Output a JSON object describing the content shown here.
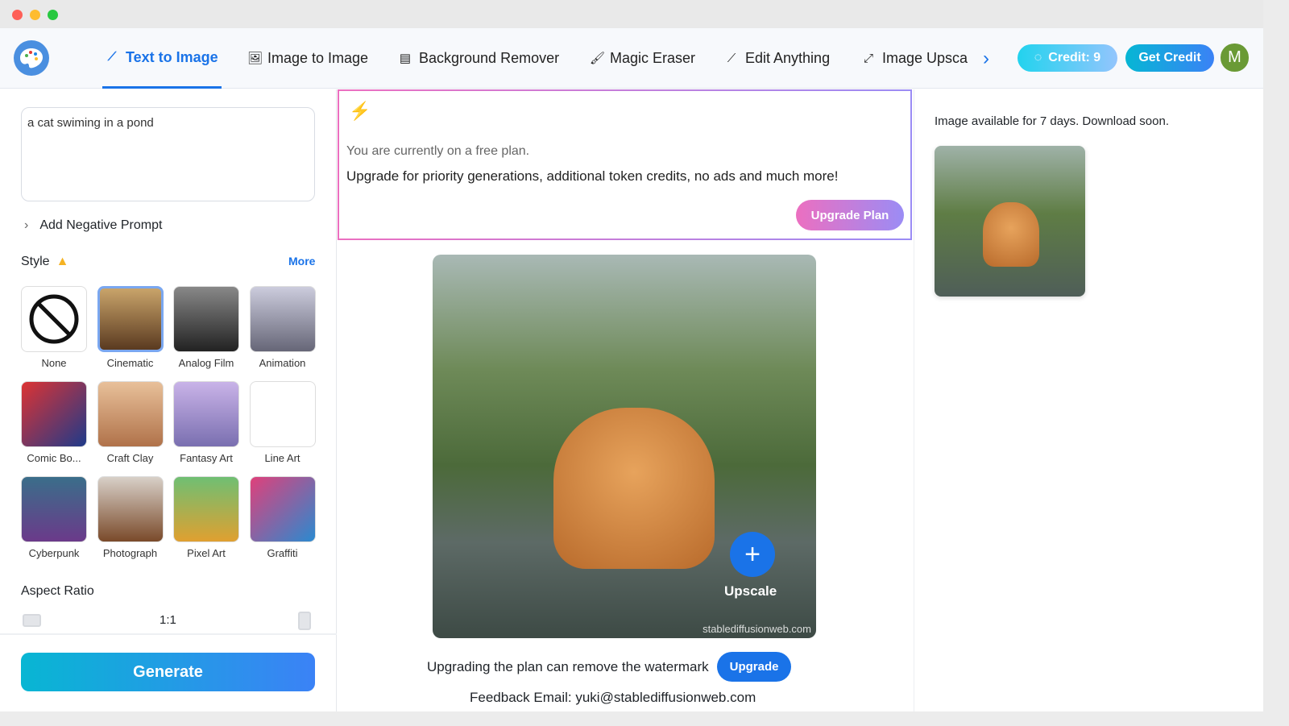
{
  "window": {
    "controls": [
      "close",
      "minimize",
      "maximize"
    ]
  },
  "nav": {
    "tabs": [
      {
        "label": "Text to Image",
        "icon": "magic-wand-icon",
        "active": true
      },
      {
        "label": "Image to Image",
        "icon": "image-icon"
      },
      {
        "label": "Background Remover",
        "icon": "background-remover-icon"
      },
      {
        "label": "Magic Eraser",
        "icon": "brush-icon"
      },
      {
        "label": "Edit Anything",
        "icon": "magic-wand-icon"
      },
      {
        "label": "Image Upsca",
        "icon": "expand-icon"
      }
    ],
    "credit_label": "Credit: 9",
    "get_credit_label": "Get Credit",
    "avatar_initial": "M"
  },
  "sidebar": {
    "prompt_value": "a cat swiming in a pond",
    "negative_prompt_label": "Add Negative Prompt",
    "style_label": "Style",
    "more_label": "More",
    "styles": [
      {
        "label": "None"
      },
      {
        "label": "Cinematic",
        "selected": true
      },
      {
        "label": "Analog Film"
      },
      {
        "label": "Animation"
      },
      {
        "label": "Comic Bo..."
      },
      {
        "label": "Craft Clay"
      },
      {
        "label": "Fantasy Art"
      },
      {
        "label": "Line Art"
      },
      {
        "label": "Cyberpunk"
      },
      {
        "label": "Photograph"
      },
      {
        "label": "Pixel Art"
      },
      {
        "label": "Graffiti"
      }
    ],
    "aspect_ratio_label": "Aspect Ratio",
    "aspect_ratio_value": "1:1",
    "generate_label": "Generate"
  },
  "banner": {
    "line1": "You are currently on a free plan.",
    "line2": "Upgrade for priority generations, additional token credits, no ads and much more!",
    "upgrade_plan_label": "Upgrade Plan"
  },
  "result": {
    "upscale_label": "Upscale",
    "watermark": "stablediffusionweb.com",
    "watermark_note": "Upgrading the plan can remove the watermark",
    "upgrade_label": "Upgrade",
    "feedback": "Feedback Email: yuki@stablediffusionweb.com"
  },
  "history": {
    "notice": "Image available for 7 days. Download soon."
  },
  "colors": {
    "accent": "#1a73e8",
    "credit_gradient": [
      "#22d3ee",
      "#93c5fd"
    ],
    "avatar": "#6a9a35",
    "upgrade_plan_gradient": [
      "#ec6fc0",
      "#9b8cf5"
    ]
  }
}
